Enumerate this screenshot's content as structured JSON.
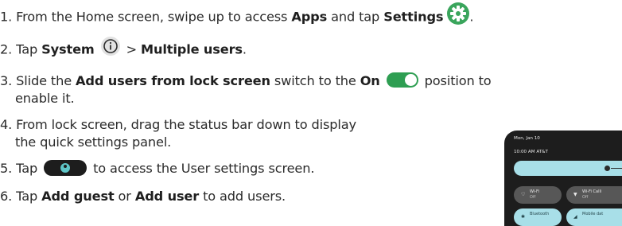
{
  "steps": [
    {
      "num": "1.",
      "pre": " From the Home screen, swipe up to access ",
      "b1": "Apps",
      "mid": " and tap ",
      "b2": "Settings",
      "post": "."
    },
    {
      "num": "2.",
      "pre": " Tap ",
      "b1": "System",
      "mid": " > ",
      "b2": "Multiple users",
      "post": "."
    },
    {
      "num": "3.",
      "pre": " Slide the ",
      "b1": "Add users from lock screen",
      "mid": " switch to the ",
      "b2": "On",
      "post": " position to",
      "cont": "enable it."
    },
    {
      "num": "4.",
      "text": " From lock screen, drag the status bar down to display",
      "cont": "the quick settings panel."
    },
    {
      "num": "5.",
      "pre": " Tap ",
      "post": " to access the User settings screen."
    },
    {
      "num": "6.",
      "pre": " Tap ",
      "b1": "Add guest",
      "mid": " or ",
      "b2": "Add user",
      "post": " to add users."
    }
  ],
  "icons": {
    "settings": "gear-icon",
    "system": "info-icon",
    "toggle": "toggle-on-icon",
    "user": "user-icon"
  },
  "colors": {
    "settings_icon": "#3aa55c",
    "toggle_on": "#2e9e52",
    "user_pill": "#1d1d1d",
    "user_dot": "#5fc7c9",
    "brightness": "#a8dfe8"
  },
  "phone": {
    "date": "Mon, Jan 10",
    "time": "10:00 AM  AT&T",
    "plus": "+",
    "tiles": [
      {
        "label": "Wi-Fi",
        "sub": "Off",
        "icon": "♡"
      },
      {
        "label": "Wi-Fi Calli",
        "sub": "Off",
        "icon": "▼"
      },
      {
        "label": "Bluetooth",
        "sub": "",
        "icon": "✱"
      },
      {
        "label": "Mobile dat",
        "sub": "",
        "icon": "◢"
      }
    ]
  }
}
